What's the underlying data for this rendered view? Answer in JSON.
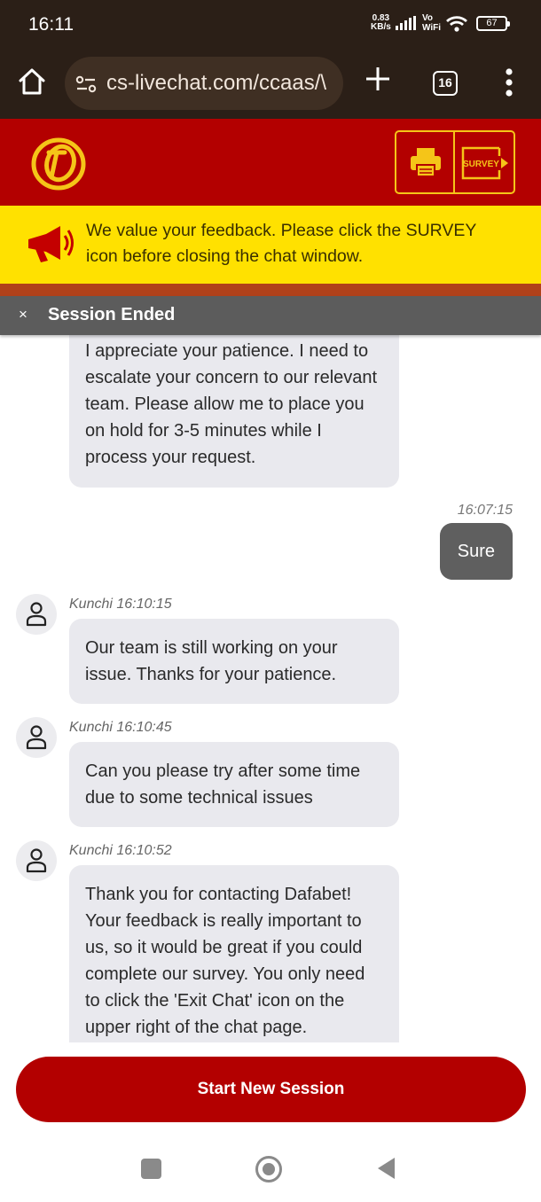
{
  "status_bar": {
    "time": "16:11",
    "net_speed_value": "0.83",
    "net_speed_unit": "KB/s",
    "vo": "Vo",
    "wifi_label": "WiFi",
    "battery": "67"
  },
  "browser": {
    "url": "cs-livechat.com/ccaas/\\",
    "tab_count": "16"
  },
  "header": {
    "survey_label": "SURVEY"
  },
  "banner": {
    "text": "We value your feedback. Please click the SURVEY icon before closing the chat window."
  },
  "session": {
    "close_glyph": "×",
    "title": "Session Ended"
  },
  "messages": [
    {
      "sender": "agent",
      "meta": "",
      "text": "I appreciate your patience. I need to escalate your concern to our relevant team. Please allow me to place you on hold for 3-5 minutes while I process your request."
    },
    {
      "sender": "user",
      "meta": "16:07:15",
      "text": "Sure"
    },
    {
      "sender": "agent",
      "meta": "Kunchi 16:10:15",
      "text": "Our team is still working on your issue. Thanks for your patience."
    },
    {
      "sender": "agent",
      "meta": "Kunchi 16:10:45",
      "text": "Can you please try after some time due to some technical issues"
    },
    {
      "sender": "agent",
      "meta": "Kunchi 16:10:52",
      "text": "Thank you for contacting Dafabet! Your feedback is really important to us, so it would be great if you could complete our survey. You only need to click the 'Exit Chat' icon on the upper right of the chat page."
    }
  ],
  "footer": {
    "new_session_label": "Start New Session"
  },
  "colors": {
    "brand_red": "#b30000",
    "banner_yellow": "#ffe100",
    "accent_gold": "#f5c518",
    "session_bar": "#5c5c5c"
  },
  "icons": [
    "home-icon",
    "site-settings-icon",
    "plus-icon",
    "tabs-icon",
    "more-vert-icon",
    "dafabet-logo",
    "printer-icon",
    "survey-exit-icon",
    "megaphone-icon",
    "close-icon",
    "user-avatar-icon",
    "nav-recents-icon",
    "nav-home-icon",
    "nav-back-icon"
  ]
}
